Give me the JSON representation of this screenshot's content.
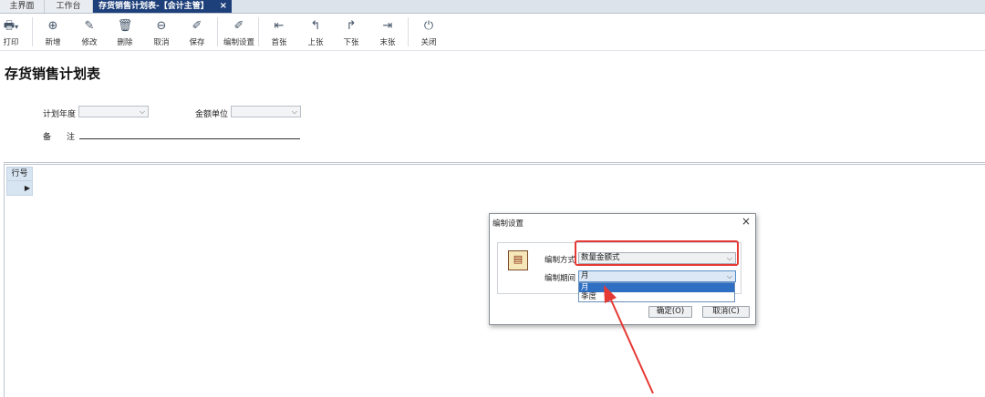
{
  "tabs": [
    {
      "label": "主界面"
    },
    {
      "label": "工作台"
    },
    {
      "label": "存货销售计划表-【会计主管】",
      "close": "×"
    }
  ],
  "toolbar": {
    "print": "打印",
    "add": "新增",
    "edit": "修改",
    "delete": "删除",
    "cancel": "取消",
    "save": "保存",
    "edit_settings": "编制设置",
    "first": "首张",
    "prev": "上张",
    "next": "下张",
    "last": "末张",
    "close": "关闭"
  },
  "page_title": "存货销售计划表",
  "form": {
    "plan_year_label": "计划年度",
    "plan_year_value": "",
    "amount_unit_label": "金额单位",
    "amount_unit_value": "",
    "remark_label_1": "备",
    "remark_label_2": "注"
  },
  "grid": {
    "row_header": "行号",
    "row_pointer": "▶"
  },
  "dialog": {
    "title": "编制设置",
    "close": "×",
    "method_label": "编制方式",
    "method_value": "数量金额式",
    "period_label": "编制期间",
    "period_value": "月",
    "period_options": [
      "月",
      "季度"
    ],
    "ok_label": "确定(O)",
    "cancel_label": "取消(C)"
  },
  "colors": {
    "active_tab": "#1d3f7a",
    "highlight": "#e53935",
    "selected_option": "#2f6fc3"
  }
}
